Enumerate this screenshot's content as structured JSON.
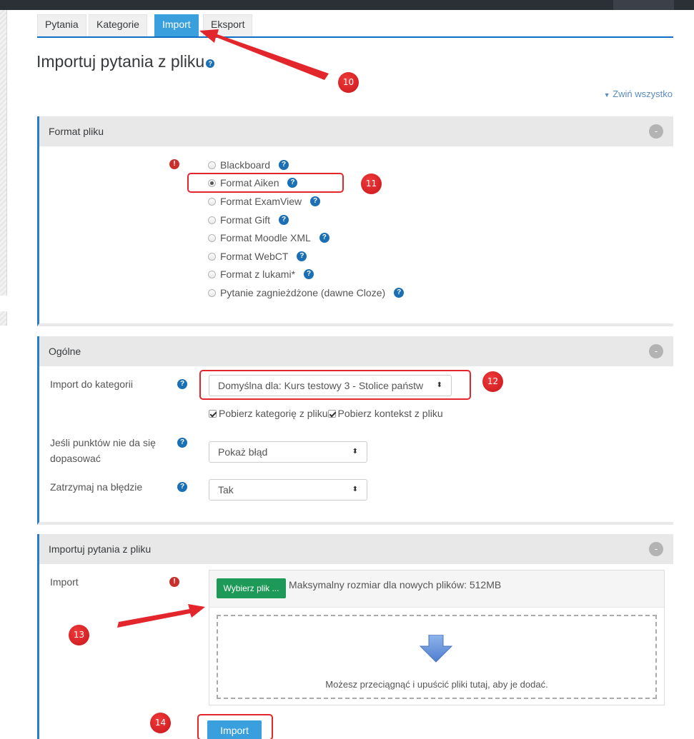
{
  "tabs": [
    {
      "label": "Pytania"
    },
    {
      "label": "Kategorie"
    },
    {
      "label": "Import"
    },
    {
      "label": "Eksport"
    }
  ],
  "page_title": "Importuj pytania z pliku",
  "collapse_all": "Zwiń wszystko",
  "sections": {
    "format": {
      "title": "Format pliku",
      "options": [
        {
          "label": "Blackboard",
          "selected": false
        },
        {
          "label": "Format Aiken",
          "selected": true
        },
        {
          "label": "Format ExamView",
          "selected": false
        },
        {
          "label": "Format Gift",
          "selected": false
        },
        {
          "label": "Format Moodle XML",
          "selected": false
        },
        {
          "label": "Format WebCT",
          "selected": false
        },
        {
          "label": "Format z lukami*",
          "selected": false
        },
        {
          "label": "Pytanie zagnieżdżone (dawne Cloze)",
          "selected": false
        }
      ]
    },
    "general": {
      "title": "Ogólne",
      "category_label": "Import do kategorii",
      "category_value": "Domyślna dla: Kurs testowy 3 - Stolice państw",
      "cb_category": "Pobierz kategorię z pliku",
      "cb_context": "Pobierz kontekst z pliku",
      "grades_label_1": "Jeśli punktów nie da się",
      "grades_label_2": "dopasować",
      "grades_value": "Pokaż błąd",
      "stop_label": "Zatrzymaj na błędzie",
      "stop_value": "Tak"
    },
    "import": {
      "title": "Importuj pytania z pliku",
      "field_label": "Import",
      "choose_file": "Wybierz plik ...",
      "max_size": "Maksymalny rozmiar dla nowych plików: 512MB",
      "drop_text": "Możesz przeciągnąć i upuścić pliki tutaj, aby je dodać."
    }
  },
  "import_button": "Import",
  "annotations": {
    "step_10": "10",
    "step_11": "11",
    "step_12": "12",
    "step_13": "13",
    "step_14": "14",
    "color": "#e3262c"
  },
  "colors": {
    "accent": "#3aa0dd",
    "choose_button": "#1e9a58",
    "section_border": "#2c7cc5"
  }
}
